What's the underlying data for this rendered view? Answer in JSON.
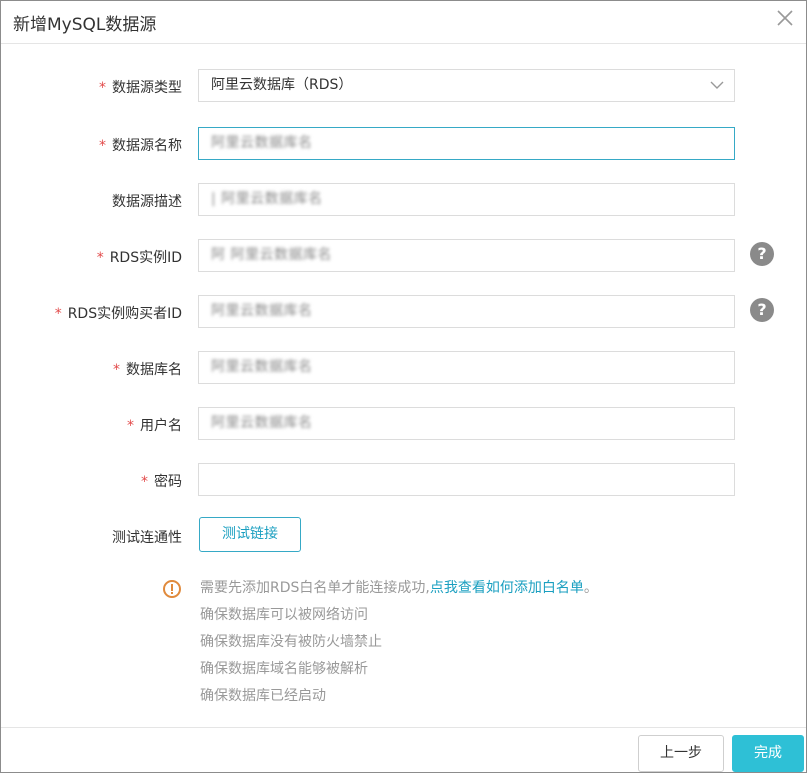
{
  "dialog": {
    "title": "新增MySQL数据源"
  },
  "form": {
    "required_mark": "*",
    "fields": [
      {
        "label": "数据源类型",
        "required": true,
        "value": "阿里云数据库（RDS）",
        "type": "select"
      },
      {
        "label": "数据源名称",
        "required": true,
        "value": "阿里云数据库名",
        "type": "input"
      },
      {
        "label": "数据源描述",
        "required": false,
        "value": "| 阿里云数据库名",
        "type": "input"
      },
      {
        "label": "RDS实例ID",
        "required": true,
        "value": "阿 阿里云数据库名",
        "type": "input",
        "help": "?"
      },
      {
        "label": "RDS实例购买者ID",
        "required": true,
        "value": "阿里云数据库名",
        "type": "input",
        "help": "?"
      },
      {
        "label": "数据库名",
        "required": true,
        "value": "阿里云数据库名",
        "type": "input"
      },
      {
        "label": "用户名",
        "required": true,
        "value": "阿里云数据库名",
        "type": "input"
      },
      {
        "label": "密码",
        "required": true,
        "value": "",
        "type": "password"
      }
    ],
    "connectivity": {
      "label": "测试连通性",
      "button": "测试链接"
    }
  },
  "tips": {
    "line1_prefix": "需要先添加RDS白名单才能连接成功,",
    "line1_link": "点我查看如何添加白名单",
    "line1_suffix": "。",
    "lines": [
      "确保数据库可以被网络访问",
      "确保数据库没有被防火墙禁止",
      "确保数据库域名能够被解析",
      "确保数据库已经启动"
    ]
  },
  "footer": {
    "prev": "上一步",
    "done": "完成"
  },
  "colors": {
    "accent": "#2ec0d6",
    "link": "#1a9fc0",
    "required": "#e24a4a",
    "warning": "#e08a3c"
  }
}
